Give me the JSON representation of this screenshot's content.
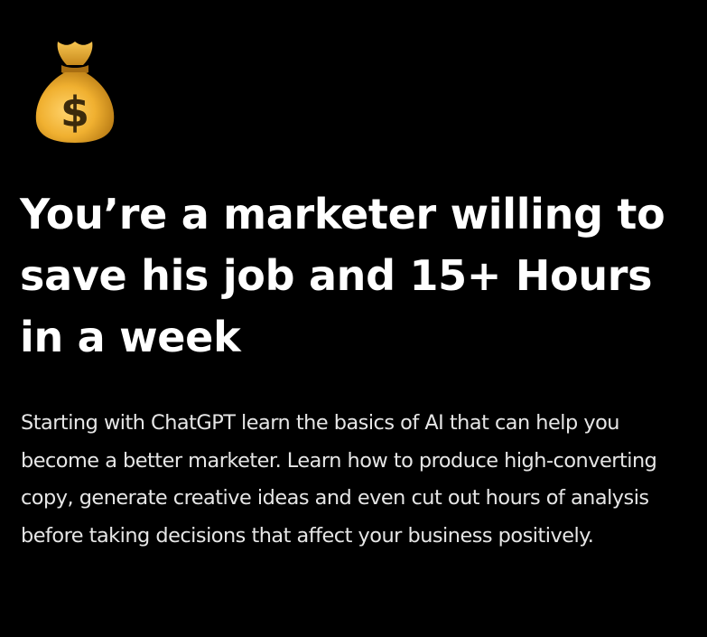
{
  "hero": {
    "icon": "money-bag-icon",
    "headline": "You’re a marketer willing to save his job and 15+ Hours in a week",
    "description": "Starting with ChatGPT learn the basics of AI that can help you become a better marketer. Learn how to produce high-converting copy, generate creative ideas and even cut out hours of analysis before taking decisions that affect your business positively."
  },
  "colors": {
    "background": "#000000",
    "headline": "#ffffff",
    "description": "#e6e6e6",
    "bag": "#f2b43a",
    "bag_shadow": "#b77a14",
    "dollar": "#3b2a0c"
  }
}
